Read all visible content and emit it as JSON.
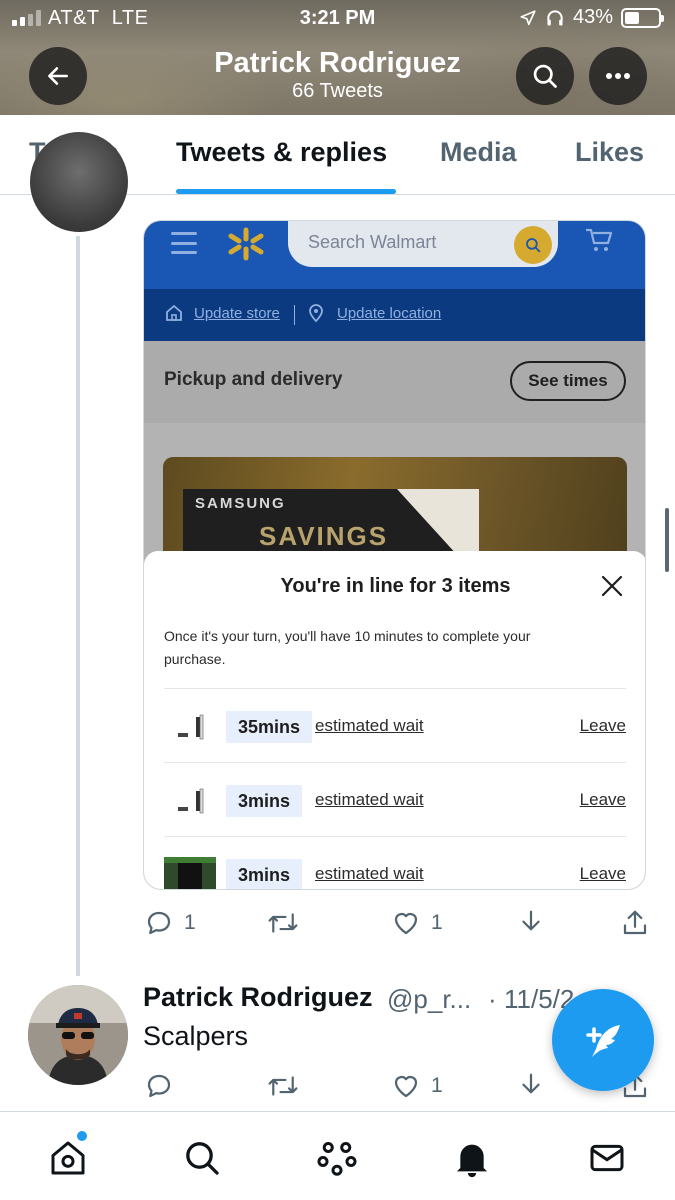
{
  "status_bar": {
    "carrier": "AT&T",
    "network": "LTE",
    "time": "3:21 PM",
    "battery": "43%",
    "battery_level": 0.43,
    "signal_bars": 2,
    "icons": [
      "location-arrow-icon",
      "headphones-icon",
      "battery-icon"
    ]
  },
  "header": {
    "title": "Patrick Rodriguez",
    "subtitle": "66 Tweets",
    "buttons": [
      "back-arrow-icon",
      "search-icon",
      "more-icon"
    ]
  },
  "tabs": [
    {
      "label": "Tweets",
      "active": false
    },
    {
      "label": "Tweets & replies",
      "active": true
    },
    {
      "label": "Media",
      "active": false
    },
    {
      "label": "Likes",
      "active": false
    }
  ],
  "tweet1": {
    "embedded_screenshot": {
      "search_placeholder": "Search Walmart",
      "update_store": "Update store",
      "update_location": "Update location",
      "pickup_label": "Pickup and delivery",
      "see_times": "See times",
      "promo_brand": "SAMSUNG",
      "promo_text": "SAVINGS",
      "queue_title": "You're in line for 3 items",
      "queue_description": "Once it's your turn, you'll have 10 minutes to complete your purchase.",
      "queue_items": [
        {
          "wait": "35mins",
          "label": "estimated wait",
          "action": "Leave",
          "thumb": "console-white"
        },
        {
          "wait": "3mins",
          "label": "estimated wait",
          "action": "Leave",
          "thumb": "console-white"
        },
        {
          "wait": "3mins",
          "label": "estimated wait",
          "action": "Leave",
          "thumb": "console-black"
        }
      ]
    },
    "actions": {
      "replies": "1",
      "likes": "1"
    }
  },
  "tweet2": {
    "name": "Patrick Rodriguez",
    "handle": "@p_r...",
    "separator": "·",
    "date": "11/5/21",
    "text": "Scalpers",
    "actions": {
      "replies": "",
      "likes": "1"
    }
  },
  "bottom_nav": [
    "home-icon",
    "search-icon",
    "spaces-icon",
    "notifications-icon",
    "messages-icon"
  ],
  "colors": {
    "accent": "#1d9bf0",
    "walmart_blue": "#1a56b3",
    "walmart_yellow": "#d6a92f"
  }
}
